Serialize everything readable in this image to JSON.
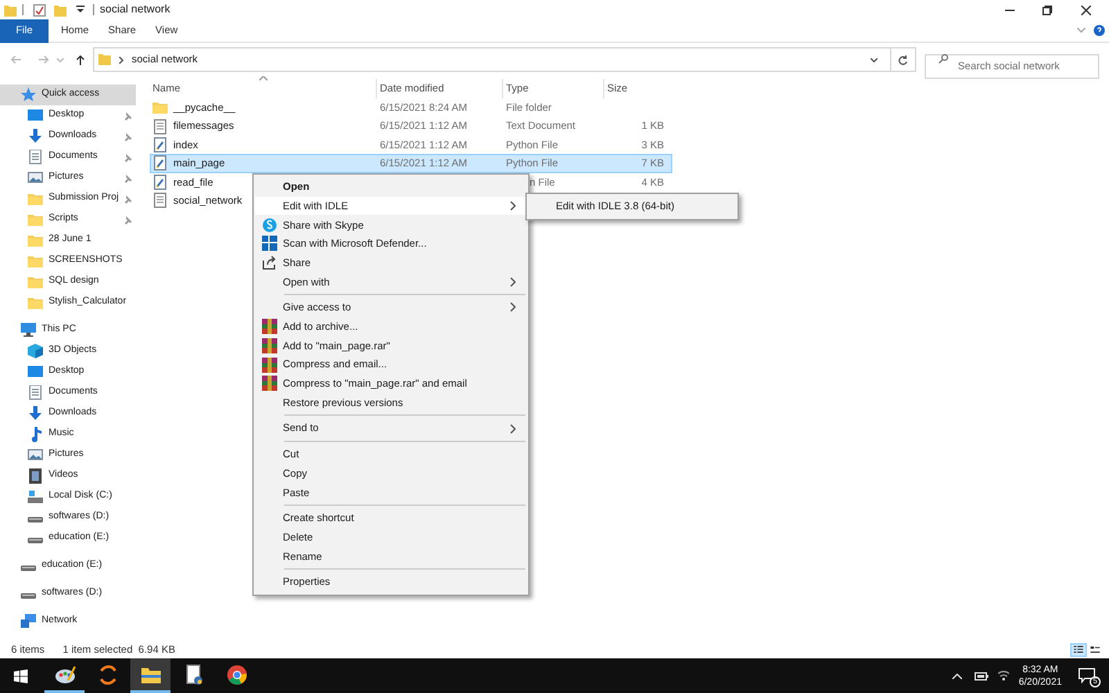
{
  "window": {
    "title": "social network"
  },
  "ribbon_tabs": [
    {
      "label": "File",
      "kind": "file"
    },
    {
      "label": "Home",
      "kind": "tab"
    },
    {
      "label": "Share",
      "kind": "tab"
    },
    {
      "label": "View",
      "kind": "tab"
    }
  ],
  "address_bar": {
    "path": "social network"
  },
  "search": {
    "placeholder": "Search social network"
  },
  "sidebar": [
    {
      "label": "Quick access",
      "kind": "star",
      "selected": true,
      "children": [
        {
          "label": "Desktop",
          "kind": "desktop",
          "pinned": true
        },
        {
          "label": "Downloads",
          "kind": "download",
          "pinned": true
        },
        {
          "label": "Documents",
          "kind": "document",
          "pinned": true
        },
        {
          "label": "Pictures",
          "kind": "pictures",
          "pinned": true
        },
        {
          "label": "Submission Proj",
          "kind": "folder",
          "pinned": true
        },
        {
          "label": "Scripts",
          "kind": "folder",
          "pinned": true
        },
        {
          "label": "28 June 1",
          "kind": "folder",
          "pinned": false
        },
        {
          "label": "SCREENSHOTS",
          "kind": "folder",
          "pinned": false
        },
        {
          "label": "SQL design",
          "kind": "folder",
          "pinned": false
        },
        {
          "label": "Stylish_Calculator",
          "kind": "folder",
          "pinned": false
        }
      ]
    },
    {
      "label": "This PC",
      "kind": "pc",
      "selected": false,
      "children": [
        {
          "label": "3D Objects",
          "kind": "cube",
          "pinned": false
        },
        {
          "label": "Desktop",
          "kind": "desktop",
          "pinned": false
        },
        {
          "label": "Documents",
          "kind": "document",
          "pinned": false
        },
        {
          "label": "Downloads",
          "kind": "download",
          "pinned": false
        },
        {
          "label": "Music",
          "kind": "music",
          "pinned": false
        },
        {
          "label": "Pictures",
          "kind": "pictures",
          "pinned": false
        },
        {
          "label": "Videos",
          "kind": "video",
          "pinned": false
        },
        {
          "label": "Local Disk (C:)",
          "kind": "system-disk",
          "pinned": false
        },
        {
          "label": "softwares (D:)",
          "kind": "drive",
          "pinned": false
        },
        {
          "label": "education (E:)",
          "kind": "drive",
          "pinned": false
        }
      ]
    },
    {
      "label": "education (E:)",
      "kind": "drive",
      "selected": false
    },
    {
      "label": "softwares (D:)",
      "kind": "drive",
      "selected": false
    },
    {
      "label": "Network",
      "kind": "network",
      "selected": false
    }
  ],
  "file_list": {
    "columns": [
      "Name",
      "Date modified",
      "Type",
      "Size"
    ],
    "rows": [
      {
        "kind": "folder",
        "name": "__pycache__",
        "date": "6/15/2021 8:24 AM",
        "type": "File folder",
        "selected": false
      },
      {
        "kind": "text",
        "name": "filemessages",
        "date": "6/15/2021 1:12 AM",
        "type": "Text Document",
        "size": "1 KB",
        "selected": false
      },
      {
        "kind": "python",
        "name": "index",
        "date": "6/15/2021 1:12 AM",
        "type": "Python File",
        "size": "3 KB",
        "selected": false
      },
      {
        "kind": "python",
        "name": "main_page",
        "date": "6/15/2021 1:12 AM",
        "type": "Python File",
        "size": "7 KB",
        "selected": true
      },
      {
        "kind": "python",
        "name": "read_file",
        "type": "n File",
        "size": "4 KB",
        "selected": false
      },
      {
        "kind": "text",
        "name": "social_network",
        "selected": false
      }
    ]
  },
  "context_menu": [
    {
      "kind": "item",
      "label": "Open",
      "default": true,
      "submenu": false,
      "selected": false
    },
    {
      "kind": "item",
      "label": "Edit with IDLE",
      "default": false,
      "submenu": true,
      "selected": true
    },
    {
      "kind": "skype",
      "label": "Share with Skype",
      "default": false,
      "submenu": false,
      "selected": false
    },
    {
      "kind": "defender",
      "label": "Scan with Microsoft Defender...",
      "default": false,
      "submenu": false,
      "selected": false
    },
    {
      "kind": "share",
      "label": "Share",
      "default": false,
      "submenu": false,
      "selected": false
    },
    {
      "kind": "item",
      "label": "Open with",
      "default": false,
      "submenu": true,
      "selected": false
    },
    {
      "kind": "separator"
    },
    {
      "kind": "item",
      "label": "Give access to",
      "default": false,
      "submenu": true,
      "selected": false
    },
    {
      "kind": "archive",
      "label": "Add to archive...",
      "default": false,
      "submenu": false,
      "selected": false
    },
    {
      "kind": "archive",
      "label": "Add to \"main_page.rar\"",
      "default": false,
      "submenu": false,
      "selected": false
    },
    {
      "kind": "archive",
      "label": "Compress and email...",
      "default": false,
      "submenu": false,
      "selected": false
    },
    {
      "kind": "archive",
      "label": "Compress to \"main_page.rar\" and email",
      "default": false,
      "submenu": false,
      "selected": false
    },
    {
      "kind": "item",
      "label": "Restore previous versions",
      "default": false,
      "submenu": false,
      "selected": false
    },
    {
      "kind": "separator"
    },
    {
      "kind": "item",
      "label": "Send to",
      "default": false,
      "submenu": true,
      "selected": false
    },
    {
      "kind": "separator"
    },
    {
      "kind": "item",
      "label": "Cut",
      "default": false,
      "submenu": false,
      "selected": false
    },
    {
      "kind": "item",
      "label": "Copy",
      "default": false,
      "submenu": false,
      "selected": false
    },
    {
      "kind": "item",
      "label": "Paste",
      "default": false,
      "submenu": false,
      "selected": false
    },
    {
      "kind": "separator"
    },
    {
      "kind": "item",
      "label": "Create shortcut",
      "default": false,
      "submenu": false,
      "selected": false
    },
    {
      "kind": "item",
      "label": "Delete",
      "default": false,
      "submenu": false,
      "selected": false
    },
    {
      "kind": "item",
      "label": "Rename",
      "default": false,
      "submenu": false,
      "selected": false
    },
    {
      "kind": "separator"
    },
    {
      "kind": "item",
      "label": "Properties",
      "default": false,
      "submenu": false,
      "selected": false
    }
  ],
  "submenu": [
    {
      "label": "Edit with IDLE 3.8 (64-bit)"
    }
  ],
  "status_bar": {
    "item_count": "6 items",
    "selection": "1 item selected  6.94 KB",
    "views": [
      {
        "kind": "details",
        "selected": true
      },
      {
        "kind": "tiles",
        "selected": false
      }
    ]
  },
  "taskbar": {
    "apps": [
      {
        "kind": "paint",
        "active": false,
        "open": true
      },
      {
        "kind": "swirl",
        "active": false,
        "open": false
      },
      {
        "kind": "explorer",
        "active": true,
        "open": true
      },
      {
        "kind": "python-file",
        "active": false,
        "open": false
      },
      {
        "kind": "chrome",
        "active": false,
        "open": false
      }
    ],
    "time": "8:32 AM",
    "date": "6/20/2021",
    "notifications": "5"
  }
}
